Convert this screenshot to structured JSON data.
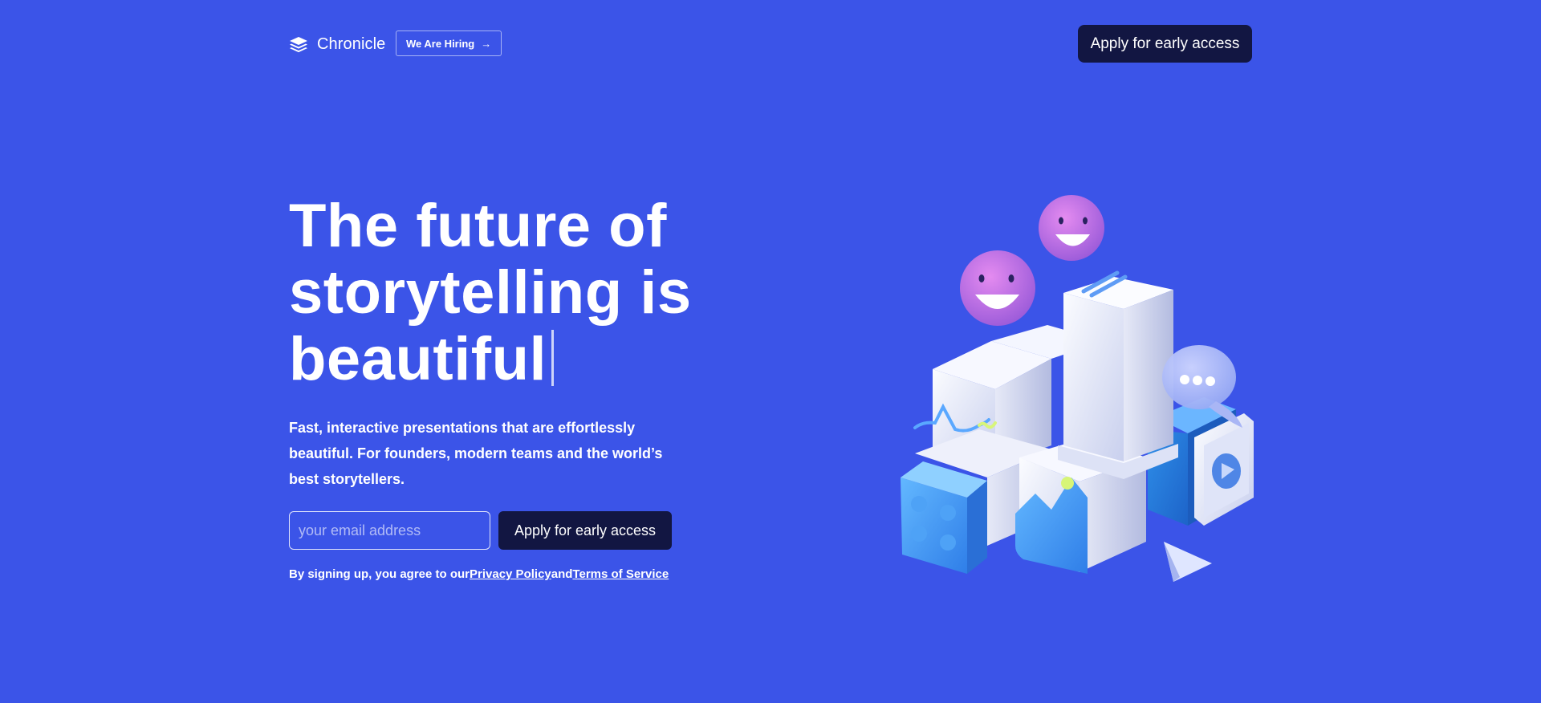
{
  "header": {
    "brand": "Chronicle",
    "hiring_label": "We Are Hiring",
    "hiring_arrow": "→",
    "cta_label": "Apply for early access"
  },
  "hero": {
    "headline": "The future of storytelling is beautiful",
    "subtext": "Fast, interactive presentations that are effortlessly beautiful. For founders, modern teams and the world’s best storytellers.",
    "email_placeholder": "your email address",
    "cta_label": "Apply for early access",
    "legal_prefix": "By signing up, you agree to our",
    "privacy_label": "Privacy Policy",
    "legal_and": "and",
    "terms_label": "Terms of Service"
  },
  "illustration": {
    "icons": [
      "smiley-emoji-icon",
      "smiley-emoji-icon",
      "chat-bubble-icon",
      "play-icon",
      "cursor-arrow-icon",
      "image-icon",
      "lego-block-icon"
    ]
  },
  "colors": {
    "background": "#3b54e8",
    "button": "#121642",
    "text": "#ffffff"
  }
}
